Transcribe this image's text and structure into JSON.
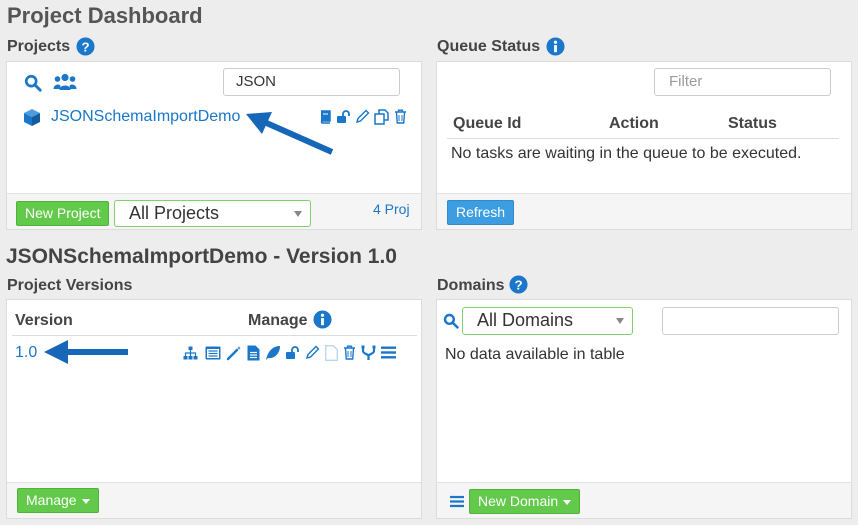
{
  "page_title": "Project Dashboard",
  "projects": {
    "title": "Projects",
    "search_value": "JSON",
    "items": [
      {
        "name": "JSONSchemaImportDemo"
      }
    ],
    "new_project_label": "New Project",
    "filter_selected": "All Projects",
    "count": "4 Proj"
  },
  "queue": {
    "title": "Queue Status",
    "filter_placeholder": "Filter",
    "columns": [
      "Queue Id",
      "Action",
      "Status"
    ],
    "empty_message": "No tasks are waiting in the queue to be executed.",
    "refresh_label": "Refresh"
  },
  "project_header": "JSONSchemaImportDemo - Version 1.0",
  "versions": {
    "title": "Project Versions",
    "col_version": "Version",
    "col_manage": "Manage",
    "rows": [
      {
        "version": "1.0"
      }
    ],
    "manage_label": "Manage"
  },
  "domains": {
    "title": "Domains",
    "filter_selected": "All Domains",
    "empty_message": "No data available in table",
    "new_domain_label": "New Domain"
  },
  "colors": {
    "accent_blue": "#1a77c9",
    "green": "#62c94a",
    "button_blue": "#3c9ee0"
  }
}
